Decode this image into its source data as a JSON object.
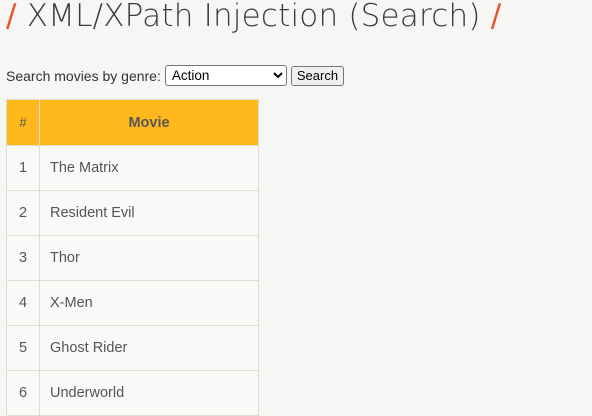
{
  "page": {
    "title_slash_left": "/",
    "title": "XML/XPath Injection (Search)",
    "title_slash_right": "/"
  },
  "search": {
    "label": "Search movies by genre:",
    "selected_genre": "Action",
    "button_label": "Search"
  },
  "table": {
    "headers": [
      "#",
      "Movie"
    ],
    "rows": [
      {
        "num": "1",
        "movie": "The Matrix"
      },
      {
        "num": "2",
        "movie": "Resident Evil"
      },
      {
        "num": "3",
        "movie": "Thor"
      },
      {
        "num": "4",
        "movie": "X-Men"
      },
      {
        "num": "5",
        "movie": "Ghost Rider"
      },
      {
        "num": "6",
        "movie": "Underworld"
      }
    ]
  },
  "colors": {
    "accent_slash": "#e8542a",
    "table_header_bg": "#ffb81c"
  }
}
